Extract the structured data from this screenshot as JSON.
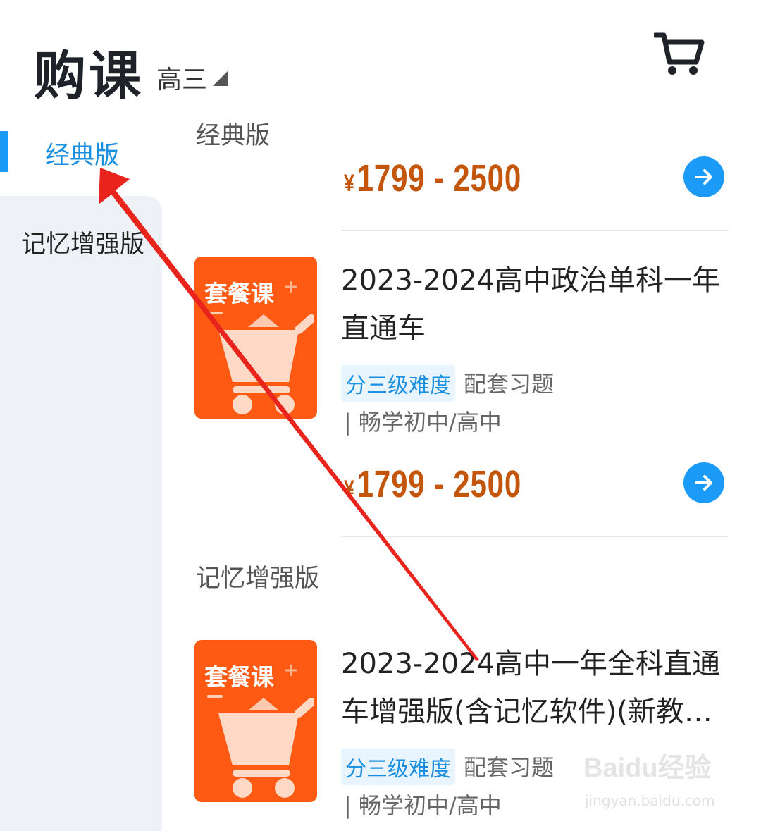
{
  "header": {
    "title": "购课",
    "grade": "高三"
  },
  "sidebar": {
    "items": [
      {
        "label": "经典版",
        "active": true
      },
      {
        "label": "记忆增强版",
        "active": false
      }
    ]
  },
  "sections": [
    {
      "title": "经典版"
    },
    {
      "title": "记忆增强版"
    }
  ],
  "top_price": {
    "yen": "¥",
    "range": "1799 - 2500"
  },
  "courses": [
    {
      "thumb_label": "套餐课",
      "title": "2023-2024高中政治单科一年直通车",
      "tag": "分三级难度",
      "extra": "配套习题",
      "teacher": "| 畅学初中/高中",
      "price_yen": "¥",
      "price": "1799 - 2500"
    },
    {
      "thumb_label": "套餐课",
      "title": "2023-2024高中一年全科直通车增强版(含记忆软件)(新教…",
      "tag": "分三级难度",
      "extra": "配套习题",
      "teacher": "| 畅学初中/高中"
    }
  ],
  "watermark": {
    "brand": "Baidu经验",
    "url": "jingyan.baidu.com"
  },
  "colors": {
    "accent": "#1b9af7",
    "price": "#c4560c",
    "thumb": "#ff5a14",
    "annotation": "#e8241c"
  },
  "icons": [
    "cart-icon",
    "arrow-right-icon",
    "dropdown-triangle-icon",
    "shopping-cart-illustration"
  ]
}
